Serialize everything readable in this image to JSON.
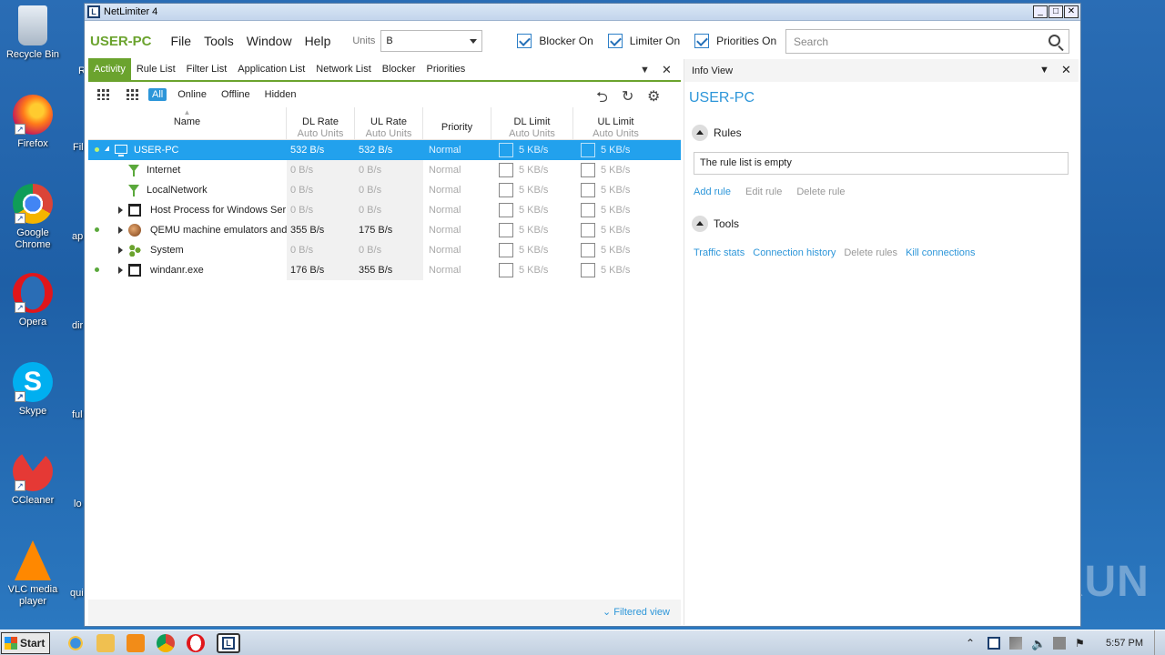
{
  "window": {
    "title": "NetLimiter 4"
  },
  "menubar": {
    "host": "USER-PC",
    "menus": [
      "File",
      "Tools",
      "Window",
      "Help"
    ],
    "units_label": "Units",
    "units_value": "B",
    "checks": [
      {
        "label": "Blocker On",
        "checked": true
      },
      {
        "label": "Limiter On",
        "checked": true
      },
      {
        "label": "Priorities On",
        "checked": true
      }
    ],
    "search_placeholder": "Search"
  },
  "tabs": [
    "Activity",
    "Rule List",
    "Filter List",
    "Application List",
    "Network List",
    "Blocker",
    "Priorities"
  ],
  "filters": [
    "All",
    "Online",
    "Offline",
    "Hidden"
  ],
  "columns": [
    {
      "label": "Name",
      "sub": ""
    },
    {
      "label": "DL Rate",
      "sub": "Auto Units"
    },
    {
      "label": "UL Rate",
      "sub": "Auto Units"
    },
    {
      "label": "Priority",
      "sub": ""
    },
    {
      "label": "DL Limit",
      "sub": "Auto Units"
    },
    {
      "label": "UL Limit",
      "sub": "Auto Units"
    }
  ],
  "rows": [
    {
      "name": "USER-PC",
      "dl": "532 B/s",
      "ul": "532 B/s",
      "priority": "Normal",
      "dl_limit": "5 KB/s",
      "ul_limit": "5 KB/s",
      "online": true,
      "icon": "computer-icon"
    },
    {
      "name": "Internet",
      "dl": "0 B/s",
      "ul": "0 B/s",
      "priority": "Normal",
      "dl_limit": "5 KB/s",
      "ul_limit": "5 KB/s",
      "online": false,
      "icon": "filter-icon"
    },
    {
      "name": "LocalNetwork",
      "dl": "0 B/s",
      "ul": "0 B/s",
      "priority": "Normal",
      "dl_limit": "5 KB/s",
      "ul_limit": "5 KB/s",
      "online": false,
      "icon": "filter-icon"
    },
    {
      "name": "Host Process for Windows Ser",
      "dl": "0 B/s",
      "ul": "0 B/s",
      "priority": "Normal",
      "dl_limit": "5 KB/s",
      "ul_limit": "5 KB/s",
      "online": false,
      "icon": "window-icon"
    },
    {
      "name": "QEMU machine emulators and",
      "dl": "355 B/s",
      "ul": "175 B/s",
      "priority": "Normal",
      "dl_limit": "5 KB/s",
      "ul_limit": "5 KB/s",
      "online": true,
      "icon": "qemu-icon"
    },
    {
      "name": "System",
      "dl": "0 B/s",
      "ul": "0 B/s",
      "priority": "Normal",
      "dl_limit": "5 KB/s",
      "ul_limit": "5 KB/s",
      "online": false,
      "icon": "system-icon"
    },
    {
      "name": "windanr.exe",
      "dl": "176 B/s",
      "ul": "355 B/s",
      "priority": "Normal",
      "dl_limit": "5 KB/s",
      "ul_limit": "5 KB/s",
      "online": true,
      "icon": "window-icon"
    }
  ],
  "filtered_view": "Filtered view",
  "info": {
    "header": "Info View",
    "host": "USER-PC",
    "rules_label": "Rules",
    "rules_empty": "The rule list is empty",
    "rule_links": [
      "Add rule",
      "Edit rule",
      "Delete rule"
    ],
    "tools_label": "Tools",
    "tool_links": [
      "Traffic stats",
      "Connection history",
      "Delete rules",
      "Kill connections"
    ]
  },
  "desktop": {
    "icons": [
      "Recycle Bin",
      "Firefox",
      "Google Chrome",
      "Opera",
      "Skype",
      "CCleaner",
      "VLC media player"
    ],
    "peek": [
      "R",
      "Fil",
      "ap",
      "dir",
      "ful",
      "lo",
      "qui"
    ]
  },
  "taskbar": {
    "start": "Start",
    "clock": "5:57 PM"
  },
  "watermark": "ANY RUN"
}
